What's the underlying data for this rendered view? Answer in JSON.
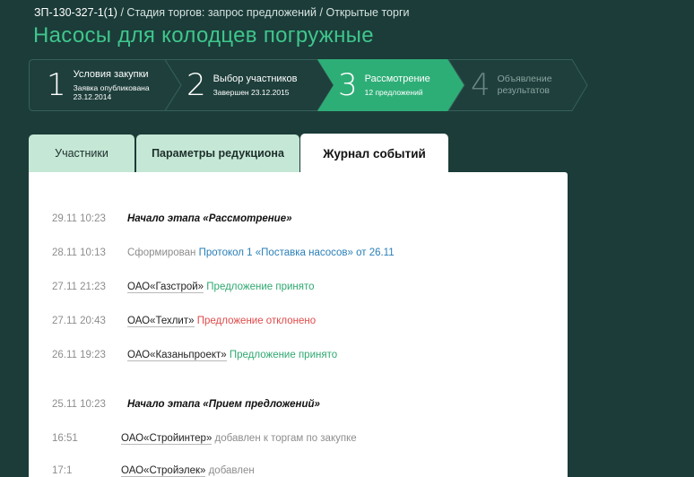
{
  "breadcrumb": {
    "code": "ЗП-130-327-1(1)",
    "separator": "/",
    "stage": "Стадия торгов: запрос предложений",
    "type": "Открытые торги"
  },
  "title": "Насосы для колодцев погружные",
  "steps": [
    {
      "num": "1",
      "title": "Условия закупки",
      "sub1": "Заявка опубликована",
      "sub2": "23.12.2014",
      "state": "done"
    },
    {
      "num": "2",
      "title": "Выбор участников",
      "sub1": "Завершен 23.12.2015",
      "state": "done"
    },
    {
      "num": "3",
      "title": "Рассмотрение",
      "sub1": "12 предложений",
      "state": "active"
    },
    {
      "num": "4",
      "title": "Объявление результатов",
      "state": "future"
    }
  ],
  "tabs": [
    {
      "label": "Участники"
    },
    {
      "label": "Параметры редукциона"
    },
    {
      "label": "Журнал событий"
    }
  ],
  "colors": {
    "background": "#1b3c39",
    "accent": "#3fc68c",
    "tab_inactive": "#c5e7d5",
    "link": "#2a7fb8",
    "accepted": "#2fa871",
    "rejected": "#e04a4a"
  },
  "log": [
    {
      "time": "29.11  10:23",
      "stage": "Начало этапа «Рассмотрение»"
    },
    {
      "time": "28.11  10:13",
      "prefix": "Сформирован",
      "link": "Протокол 1 «Поставка насосов» от 26.11"
    },
    {
      "time": "27.11  21:23",
      "party": "ОАО«Газстрой»",
      "status": "Предложение принято"
    },
    {
      "time": "27.11  20:43",
      "party": "ОАО«Техлит»",
      "status": "Предложение отклонено"
    },
    {
      "time": "26.11  19:23",
      "party": "ОАО«Казаньпроект»",
      "status": "Предложение принято"
    },
    {
      "time": "25.11  10:23",
      "stage": "Начало этапа «Прием предложений»"
    },
    {
      "time": "16:51",
      "party": "ОАО«Стройинтер»",
      "note": "добавлен к торгам по закупке"
    },
    {
      "time": "17:1",
      "party": "ОАО«Стройэлек»",
      "note": "добавлен"
    }
  ]
}
